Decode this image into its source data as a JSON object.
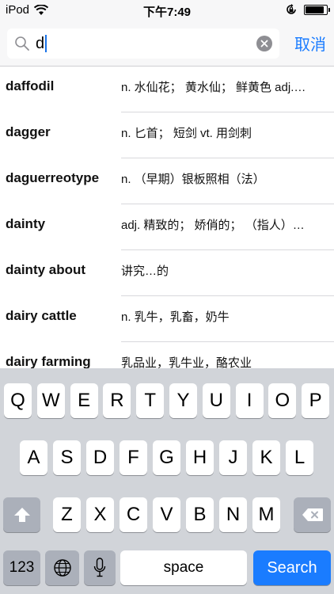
{
  "status_bar": {
    "carrier": "iPod",
    "time": "下午7:49",
    "icons": [
      "wifi-icon",
      "rotation-lock-icon",
      "battery-icon"
    ],
    "battery_level": 0.9
  },
  "search": {
    "value": "d",
    "cancel_label": "取消",
    "accent_color": "#1a7cff"
  },
  "results": [
    {
      "word": "daffodil",
      "definition": "n. 水仙花； 黄水仙； 鲜黄色 adj.…"
    },
    {
      "word": "dagger",
      "definition": "n. 匕首； 短剑 vt. 用剑刺"
    },
    {
      "word": "daguerreotype",
      "definition": "n. （早期）银板照相（法）"
    },
    {
      "word": "dainty",
      "definition": "adj. 精致的； 娇俏的； （指人）…"
    },
    {
      "word": "dainty about",
      "definition": "讲究…的"
    },
    {
      "word": "dairy cattle",
      "definition": "n. 乳牛，乳畜，奶牛"
    },
    {
      "word": "dairy farming",
      "definition": "乳品业，乳牛业，酪农业"
    }
  ],
  "keyboard": {
    "row1": [
      "Q",
      "W",
      "E",
      "R",
      "T",
      "Y",
      "U",
      "I",
      "O",
      "P"
    ],
    "row2": [
      "A",
      "S",
      "D",
      "F",
      "G",
      "H",
      "J",
      "K",
      "L"
    ],
    "row3": [
      "Z",
      "X",
      "C",
      "V",
      "B",
      "N",
      "M"
    ],
    "numbers_label": "123",
    "space_label": "space",
    "search_label": "Search"
  }
}
